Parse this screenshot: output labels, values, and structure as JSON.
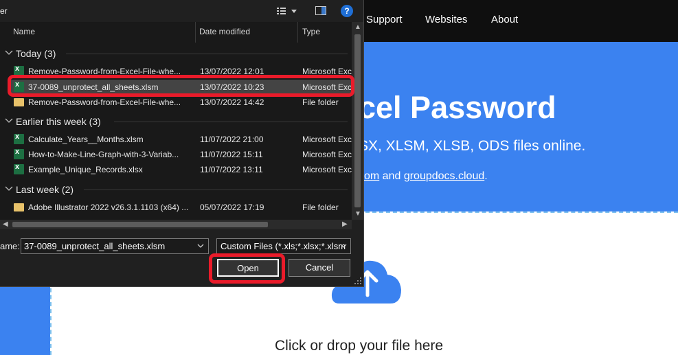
{
  "web": {
    "nav": [
      "Support",
      "Websites",
      "About"
    ],
    "hero_title": "cel Password",
    "hero_subtitle": "SX, XLSM, XLSB, ODS files online.",
    "hero_links": {
      "link1": "com",
      "middle": " and ",
      "link2": "groupdocs.cloud",
      "end": "."
    },
    "drop_text": "Click or drop your file here"
  },
  "dialog": {
    "title": "er",
    "columns": {
      "name": "Name",
      "date": "Date modified",
      "type": "Type"
    },
    "groups": [
      {
        "label": "Today (3)",
        "rows": [
          {
            "icon": "excel-file-icon",
            "name": "Remove-Password-from-Excel-File-whe...",
            "date": "13/07/2022 12:01",
            "type": "Microsoft Excel"
          },
          {
            "icon": "excel-file-icon",
            "name": "37-0089_unprotect_all_sheets.xlsm",
            "date": "13/07/2022 10:23",
            "type": "Microsoft Excel",
            "selected": true
          },
          {
            "icon": "folder-icon",
            "name": "Remove-Password-from-Excel-File-whe...",
            "date": "13/07/2022 14:42",
            "type": "File folder"
          }
        ]
      },
      {
        "label": "Earlier this week (3)",
        "rows": [
          {
            "icon": "excel-file-icon",
            "name": "Calculate_Years__Months.xlsm",
            "date": "11/07/2022 21:00",
            "type": "Microsoft Excel"
          },
          {
            "icon": "excel-file-icon",
            "name": "How-to-Make-Line-Graph-with-3-Variab...",
            "date": "11/07/2022 15:11",
            "type": "Microsoft Excel"
          },
          {
            "icon": "excel-file-icon",
            "name": "Example_Unique_Records.xlsx",
            "date": "11/07/2022 13:11",
            "type": "Microsoft Excel"
          }
        ]
      },
      {
        "label": "Last week (2)",
        "rows": [
          {
            "icon": "folder-icon",
            "name": "Adobe Illustrator 2022 v26.3.1.1103 (x64) ...",
            "date": "05/07/2022 17:19",
            "type": "File folder"
          }
        ]
      }
    ],
    "filename_label": "ame:",
    "filename_value": "37-0089_unprotect_all_sheets.xlsm",
    "filter_value": "Custom Files (*.xls;*.xlsx;*.xlsm",
    "open_label": "Open",
    "cancel_label": "Cancel",
    "help_label": "?"
  },
  "colors": {
    "highlight": "#ea1b2a",
    "hero_blue": "#3b82f0",
    "dialog_bg": "#202020"
  }
}
